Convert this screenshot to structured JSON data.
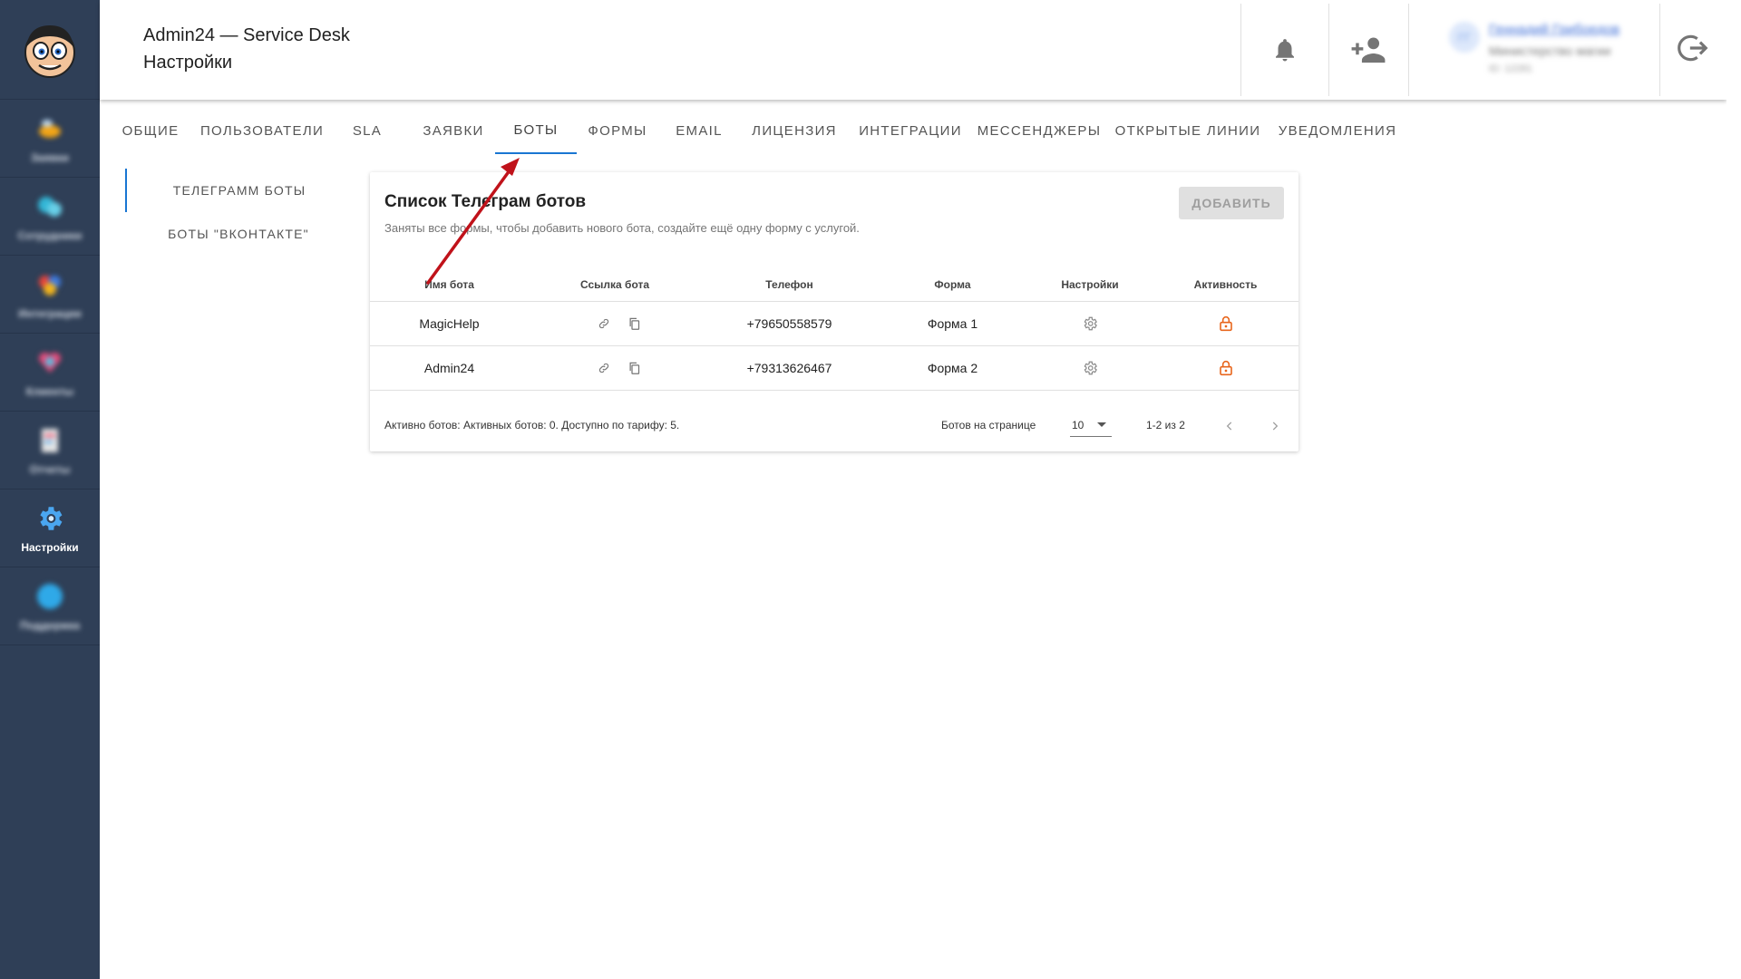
{
  "sidebar": {
    "items": [
      {
        "label": "Заявки",
        "icon": "bee-icon",
        "blurred": true
      },
      {
        "label": "Сотрудники",
        "icon": "people-icon",
        "blurred": true
      },
      {
        "label": "Интеграции",
        "icon": "integrations-icon",
        "blurred": true
      },
      {
        "label": "Клиенты",
        "icon": "clients-icon",
        "blurred": true
      },
      {
        "label": "Отчеты",
        "icon": "reports-icon",
        "blurred": true
      },
      {
        "label": "Настройки",
        "icon": "gear-icon",
        "blurred": false
      },
      {
        "label": "Поддержка",
        "icon": "support-icon",
        "blurred": true
      }
    ]
  },
  "header": {
    "app_title": "Admin24 — Service Desk",
    "page_title": "Настройки",
    "user": {
      "initials": "ГГ",
      "name": "Геннадий Грибоедов",
      "org": "Министерство магии",
      "id": "ID: 12281"
    }
  },
  "tabs": [
    {
      "label": "ОБЩИЕ",
      "active": false
    },
    {
      "label": "ПОЛЬЗОВАТЕЛИ",
      "active": false
    },
    {
      "label": "SLA",
      "active": false
    },
    {
      "label": "ЗАЯВКИ",
      "active": false
    },
    {
      "label": "БОТЫ",
      "active": true
    },
    {
      "label": "ФОРМЫ",
      "active": false
    },
    {
      "label": "EMAIL",
      "active": false
    },
    {
      "label": "ЛИЦЕНЗИЯ",
      "active": false
    },
    {
      "label": "ИНТЕГРАЦИИ",
      "active": false
    },
    {
      "label": "МЕССЕНДЖЕРЫ",
      "active": false
    },
    {
      "label": "ОТКРЫТЫЕ ЛИНИИ",
      "active": false
    },
    {
      "label": "УВЕДОМЛЕНИЯ",
      "active": false
    }
  ],
  "subnav": [
    {
      "label": "ТЕЛЕГРАММ БОТЫ",
      "active": true
    },
    {
      "label": "БОТЫ \"ВКОНТАКТЕ\"",
      "active": false
    }
  ],
  "card": {
    "title": "Список Телеграм ботов",
    "subtitle": "Заняты все формы, чтобы добавить нового бота, создайте ещё одну форму с услугой.",
    "add_label": "ДОБАВИТЬ",
    "columns": [
      "Имя бота",
      "Ссылка бота",
      "Телефон",
      "Форма",
      "Настройки",
      "Активность"
    ],
    "rows": [
      {
        "name": "MagicHelp",
        "phone": "+79650558579",
        "form": "Форма 1"
      },
      {
        "name": "Admin24",
        "phone": "+79313626467",
        "form": "Форма 2"
      }
    ],
    "footer": {
      "summary": "Активно ботов: Активных ботов: 0. Доступно по тарифу: 5.",
      "per_page_label": "Ботов на странице",
      "per_page_value": "10",
      "range": "1-2 из 2"
    }
  },
  "colors": {
    "sidebar_bg": "#2f3f57",
    "accent": "#1976d2",
    "lock": "#e8651c",
    "arrow": "#c0121a"
  }
}
